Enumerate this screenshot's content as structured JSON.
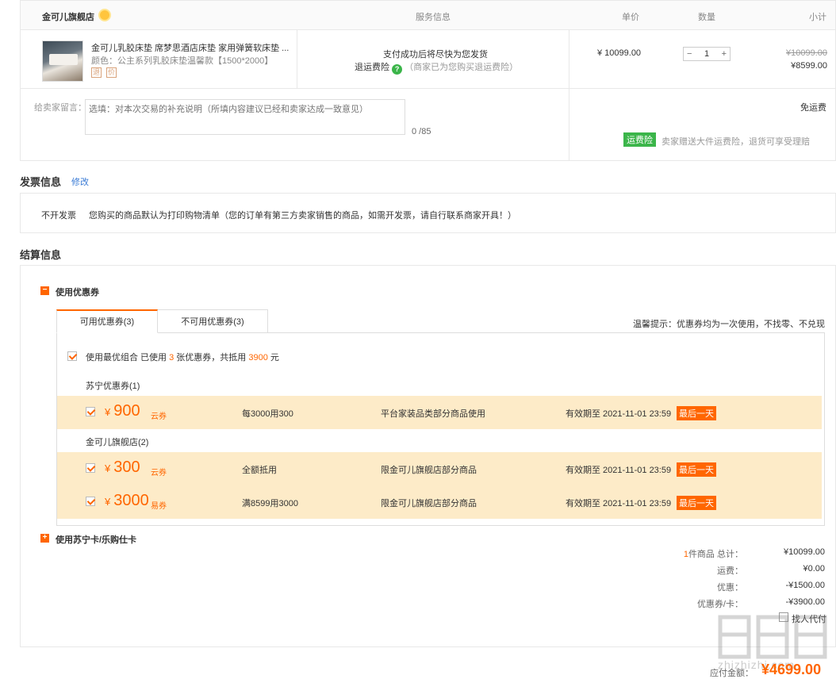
{
  "order": {
    "shop_name": "金可儿旗舰店",
    "header": {
      "service": "服务信息",
      "unit_price": "单价",
      "quantity": "数量",
      "subtotal": "小计"
    },
    "item": {
      "title": "金可儿乳胶床垫 席梦思酒店床垫 家用弹簧软床垫 ...",
      "spec": "颜色：公主系列乳胶床垫温馨款【1500*2000】",
      "tag1": "退",
      "tag2": "价",
      "service_line1": "支付成功后将尽快为您发货",
      "service_insurance": "退运费险",
      "service_note": "（商家已为您购买退运费险）",
      "price": "¥ 10099.00",
      "qty_minus": "−",
      "qty": "1",
      "qty_plus": "+",
      "old_subtotal": "¥10099.00",
      "new_subtotal": "¥8599.00"
    },
    "message_label": "给卖家留言：",
    "message_placeholder": "选填：对本次交易的补充说明（所填内容建议已经和卖家达成一致意见）",
    "message_count": "0 /85",
    "shipping": "免运费",
    "insurance_badge": "运费险",
    "insurance_note": "卖家赠送大件运费险，退货可享受理赔"
  },
  "invoice": {
    "title": "发票信息",
    "edit": "修改",
    "type": "不开发票",
    "note": "您购买的商品默认为打印购物清单（您的订单有第三方卖家销售的商品，如需开发票，请自行联系商家开具！）"
  },
  "settlement": {
    "title": "结算信息",
    "coupon_toggle_icon": "−",
    "coupon_toggle": "使用优惠券",
    "tabs": [
      "可用优惠券(3)",
      "不可用优惠券(3)"
    ],
    "tip": "温馨提示：优惠券均为一次使用，不找零、不兑现",
    "best_combo_a": "使用最优组合   已使用 ",
    "best_combo_count": "3",
    "best_combo_b": " 张优惠券，共抵用 ",
    "best_combo_amount": "3900",
    "best_combo_c": " 元",
    "groups": [
      {
        "name": "苏宁优惠券(1)"
      },
      {
        "name": "金可儿旗舰店(2)"
      }
    ],
    "coupons": [
      {
        "yen": "¥",
        "amount": "900",
        "source": "云券",
        "rule": "每3000用300",
        "scope": "平台家装品类部分商品使用",
        "expiry": "有效期至 2021-11-01 23:59",
        "badge": "最后一天"
      },
      {
        "yen": "¥",
        "amount": "300",
        "source": "云券",
        "rule": "全额抵用",
        "scope": "限金可儿旗舰店部分商品",
        "expiry": "有效期至 2021-11-01 23:59",
        "badge": "最后一天"
      },
      {
        "yen": "¥",
        "amount": "3000",
        "source": "易券",
        "rule": "满8599用3000",
        "scope": "限金可儿旗舰店部分商品",
        "expiry": "有效期至 2021-11-01 23:59",
        "badge": "最后一天"
      }
    ],
    "card_toggle_icon": "+",
    "card_toggle": "使用苏宁卡/乐购仕卡",
    "summary": {
      "count": "1",
      "total_label": "件商品 总计：",
      "total": "¥10099.00",
      "shipping_label": "运费：",
      "shipping": "¥0.00",
      "discount_label": "优惠：",
      "discount": "-¥1500.00",
      "coupon_label": "优惠券/卡：",
      "coupon": "-¥3900.00",
      "agent_pay": "找人代付",
      "pay_label": "应付金额：",
      "pay": "¥4699.00"
    }
  },
  "watermark": "zhizhizhi.com"
}
